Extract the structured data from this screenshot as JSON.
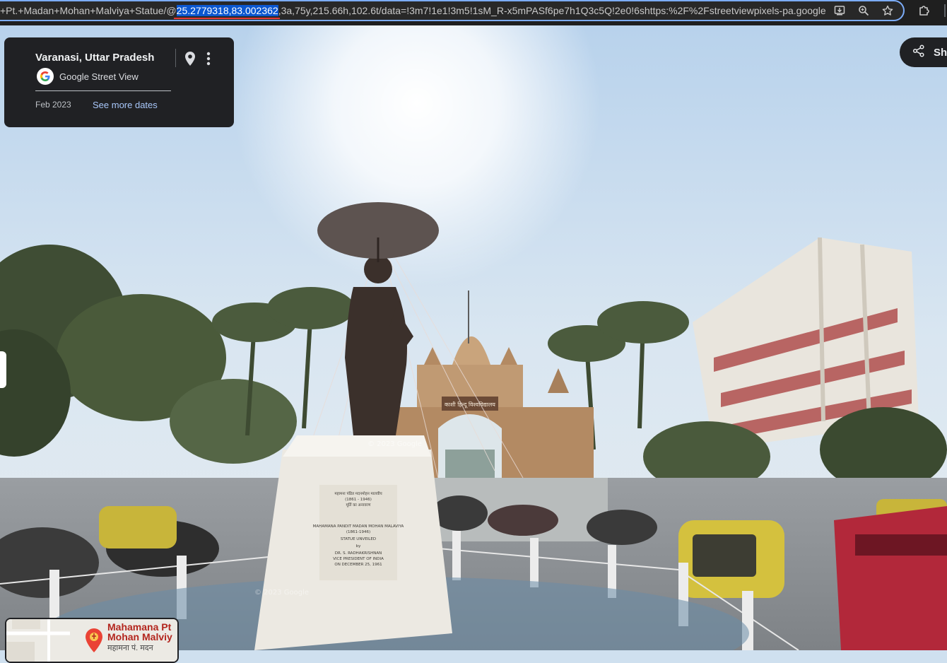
{
  "browser": {
    "url_prefix": "+Pt.+Madan+Mohan+Malviya+Statue/@",
    "url_selected": "25.2779318,83.002362",
    "url_suffix": ",3a,75y,215.66h,102.6t/data=!3m7!1e1!3m5!1sM_R-x5mPASf6pe7h1Q3c5Q!2e0!6shttps:%2F%2Fstreetviewpixels-pa.googleapi",
    "icons": [
      "install-app-icon",
      "zoom-icon",
      "bookmark-star-icon",
      "extensions-icon"
    ]
  },
  "info_card": {
    "place_title": "Varanasi, Uttar Pradesh",
    "source_label": "Google Street View",
    "capture_date": "Feb 2023",
    "more_dates_link": "See more dates"
  },
  "share": {
    "label": "Sha"
  },
  "scene": {
    "gate_sign": "काशी हिन्दू विश्वविद्यालय",
    "plaque_lines": [
      "महामना पंडित मदनमोहन मालवीय",
      "(1861 - 1946)",
      "मूर्ति का अनावरण",
      "MAHAMANA PANDIT MADAN MOHAN MALAVIYA",
      "(1861-1946)",
      "STATUE UNVEILED",
      "by",
      "DR. S. RADHAKRISHNAN",
      "VICE PRESIDENT OF INDIA",
      "ON DECEMBER 25, 1961"
    ],
    "watermark": "© 2023 Google"
  },
  "minimap": {
    "label_line1": "Mahamana Pt",
    "label_line2": "Mohan Malviy",
    "label_hindi": "महामना पं. मदन"
  }
}
